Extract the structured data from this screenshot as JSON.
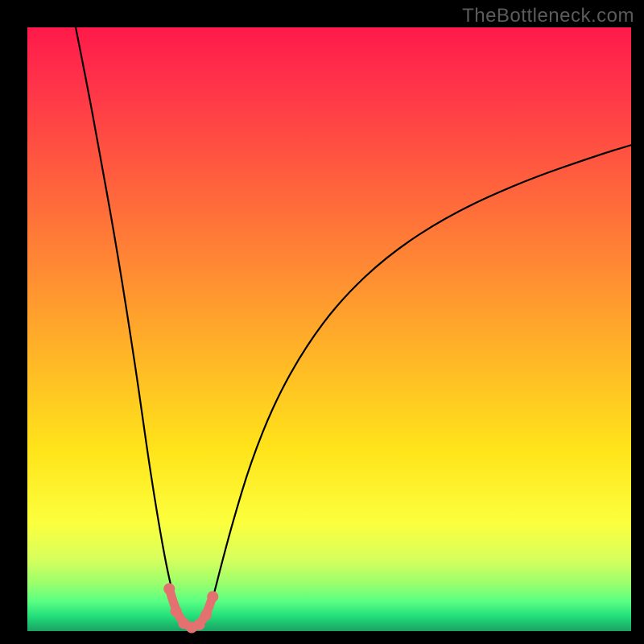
{
  "watermark": "TheBottleneck.com",
  "colors": {
    "background_frame": "#000000",
    "gradient_top": "#ff1a49",
    "gradient_mid": "#ffe41a",
    "gradient_bottom": "#1aa162",
    "curve_stroke": "#000000",
    "marker_color": "#e2716f"
  },
  "chart_data": {
    "type": "line",
    "title": "",
    "xlabel": "",
    "ylabel": "",
    "xlim": [
      0,
      100
    ],
    "ylim": [
      0,
      100
    ],
    "grid": false,
    "legend": false,
    "annotations": [
      "TheBottleneck.com"
    ],
    "series": [
      {
        "name": "left-branch",
        "x": [
          8,
          10,
          12,
          14,
          16,
          18,
          19,
          20,
          21,
          22,
          23,
          24,
          25,
          25.7
        ],
        "y": [
          100,
          90,
          79,
          68,
          56,
          43,
          36,
          29,
          22.5,
          16.5,
          11,
          6.5,
          3,
          1.2
        ]
      },
      {
        "name": "right-branch",
        "x": [
          29.3,
          30,
          31,
          32,
          34,
          37,
          41,
          46,
          52,
          60,
          70,
          82,
          95,
          100
        ],
        "y": [
          1.2,
          3,
          6.5,
          10.5,
          18,
          28,
          38,
          47,
          55,
          62.5,
          69,
          74.5,
          79,
          80.5
        ]
      },
      {
        "name": "valley-floor",
        "x": [
          25.7,
          26.5,
          27.5,
          28.5,
          29.3
        ],
        "y": [
          1.2,
          0.5,
          0.3,
          0.5,
          1.2
        ]
      }
    ],
    "markers": {
      "name": "valley-markers",
      "color": "#e2716f",
      "points_xy": [
        [
          23.5,
          7.0
        ],
        [
          24.6,
          3.3
        ],
        [
          25.9,
          1.3
        ],
        [
          27.2,
          0.6
        ],
        [
          28.5,
          1.1
        ],
        [
          29.6,
          2.7
        ],
        [
          30.7,
          5.7
        ]
      ]
    }
  }
}
